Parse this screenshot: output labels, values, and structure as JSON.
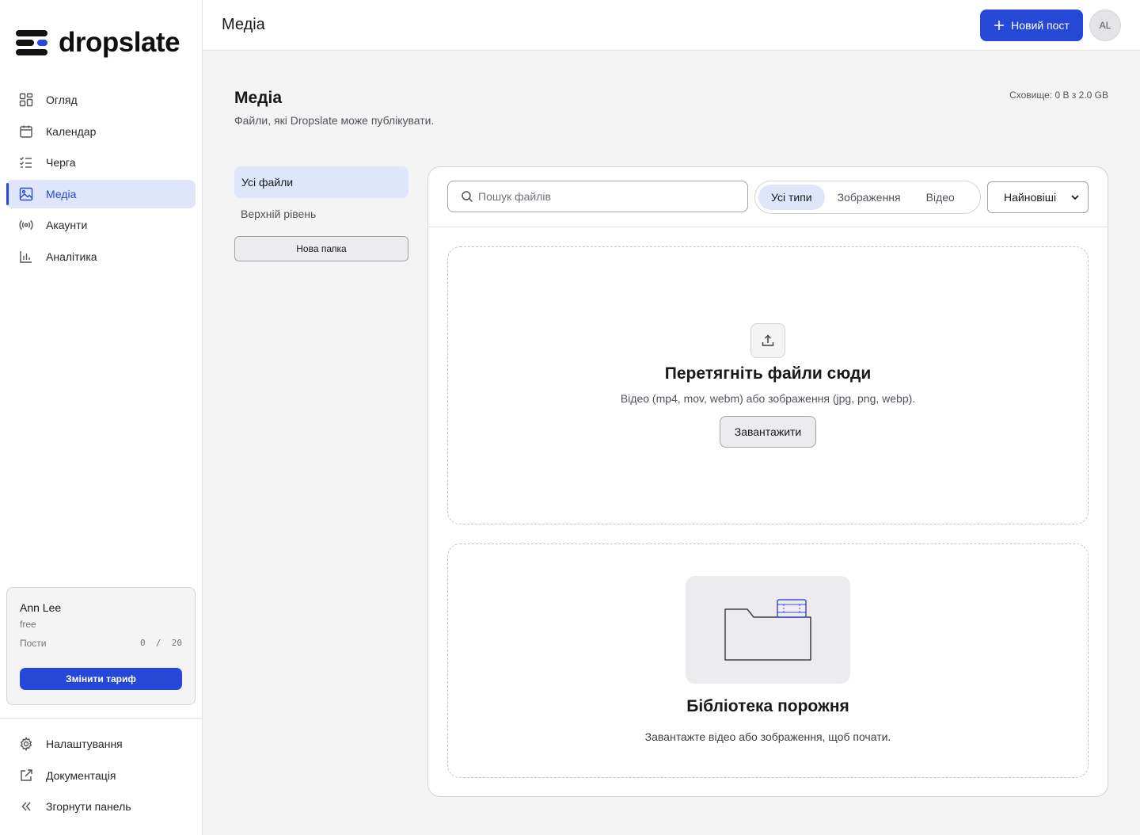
{
  "brand": {
    "name": "dropslate",
    "accent": "#2747d6"
  },
  "nav": {
    "items": [
      {
        "label": "Огляд",
        "icon": "grid-icon"
      },
      {
        "label": "Календар",
        "icon": "calendar-icon"
      },
      {
        "label": "Черга",
        "icon": "checklist-icon"
      },
      {
        "label": "Медіа",
        "icon": "image-icon",
        "active": true
      },
      {
        "label": "Акаунти",
        "icon": "broadcast-icon"
      },
      {
        "label": "Аналітика",
        "icon": "bar-chart-icon"
      }
    ],
    "bottom": [
      {
        "label": "Налаштування",
        "icon": "gear-icon"
      },
      {
        "label": "Документація",
        "icon": "external-link-icon"
      },
      {
        "label": "Згорнути панель",
        "icon": "chevrons-left-icon"
      }
    ]
  },
  "plan": {
    "user_name": "Ann Lee",
    "tier": "free",
    "posts_label": "Пости",
    "posts_used": "0",
    "posts_sep": "/",
    "posts_limit": "20",
    "upgrade_label": "Змінити тариф"
  },
  "topbar": {
    "title": "Медіа",
    "new_post_label": "Новий пост",
    "avatar_initials": "AL"
  },
  "page": {
    "title": "Медіа",
    "subtitle": "Файли, які Dropslate може публікувати.",
    "storage": "Сховище: 0 B з 2.0 GB"
  },
  "folders": {
    "all": "Усі файли",
    "top_level": "Верхній рівень",
    "new_folder": "Нова папка"
  },
  "toolbar": {
    "search_placeholder": "Пошук файлів",
    "types": [
      "Усі типи",
      "Зображення",
      "Відео"
    ],
    "active_type": "Усі типи",
    "sort": "Найновіші"
  },
  "dropzone": {
    "title": "Перетягніть файли сюди",
    "subtitle": "Відео (mp4, mov, webm) або зображення (jpg, png, webp).",
    "upload_label": "Завантажити"
  },
  "empty": {
    "title": "Бібліотека порожня",
    "subtitle": "Завантажте відео або зображення, щоб почати."
  }
}
